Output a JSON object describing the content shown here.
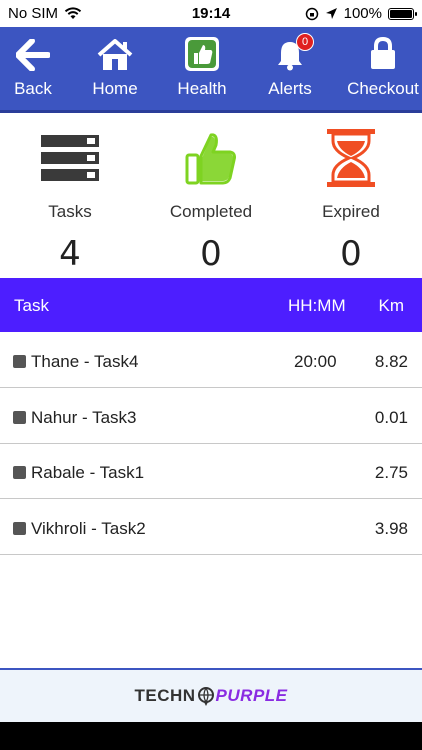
{
  "status_bar": {
    "carrier": "No SIM",
    "time": "19:14",
    "battery": "100%"
  },
  "nav": {
    "items": [
      {
        "label": "Back",
        "icon": "back-arrow-icon"
      },
      {
        "label": "Home",
        "icon": "home-icon"
      },
      {
        "label": "Health",
        "icon": "thumbs-up-icon"
      },
      {
        "label": "Alerts",
        "icon": "bell-icon",
        "badge": "0"
      },
      {
        "label": "Checkout",
        "icon": "lock-icon"
      }
    ]
  },
  "summary": {
    "tasks": {
      "label": "Tasks",
      "count": "4",
      "icon": "server-stack-icon"
    },
    "completed": {
      "label": "Completed",
      "count": "0",
      "icon": "thumbs-up-icon",
      "color": "#7ed321"
    },
    "expired": {
      "label": "Expired",
      "count": "0",
      "icon": "hourglass-icon",
      "color": "#f04e23"
    }
  },
  "table": {
    "headers": {
      "task": "Task",
      "time": "HH:MM",
      "km": "Km"
    },
    "rows": [
      {
        "name": "Thane - Task4",
        "time": "20:00",
        "km": "8.82"
      },
      {
        "name": "Nahur - Task3",
        "time": "",
        "km": "0.01"
      },
      {
        "name": "Rabale - Task1",
        "time": "",
        "km": "2.75"
      },
      {
        "name": "Vikhroli - Task2",
        "time": "",
        "km": "3.98"
      }
    ]
  },
  "footer": {
    "brand_part1": "TECHN",
    "brand_part2": "PURPLE"
  },
  "colors": {
    "nav_bg": "#3c55c1",
    "table_header_bg": "#4d1eff",
    "brand_purple": "#8a2be2"
  }
}
